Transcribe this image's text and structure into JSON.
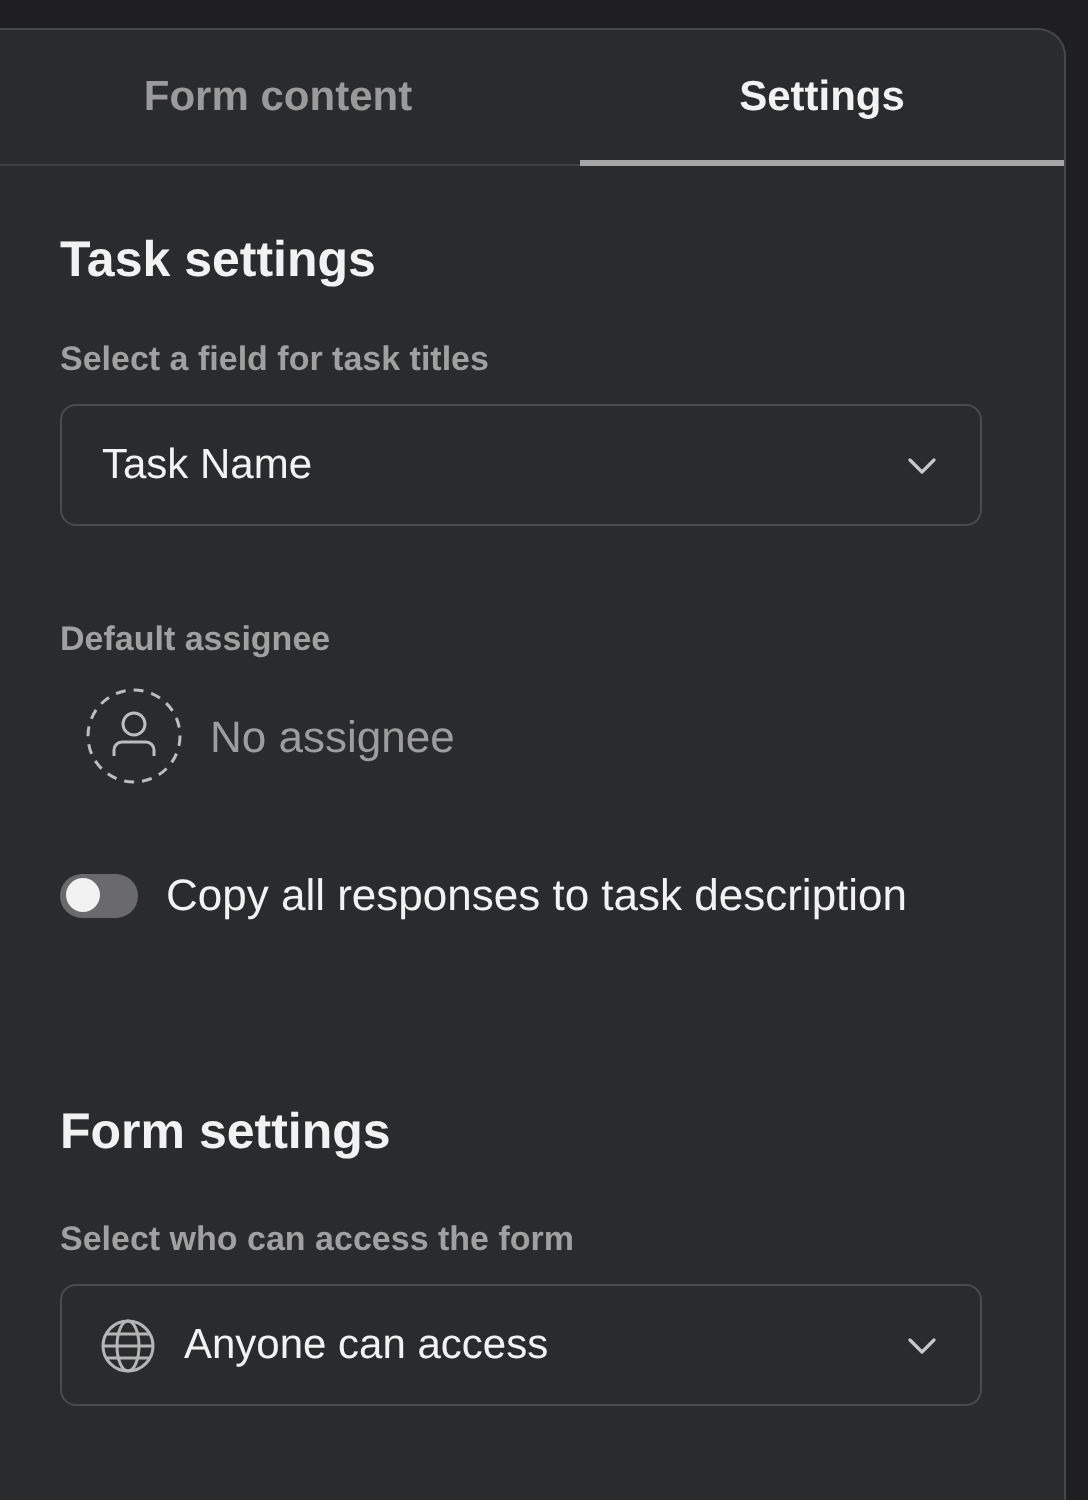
{
  "tabs": [
    {
      "label": "Form content",
      "selected": false
    },
    {
      "label": "Settings",
      "selected": true
    }
  ],
  "task_settings": {
    "heading": "Task settings",
    "title_field": {
      "label": "Select a field for task titles",
      "value": "Task Name"
    },
    "default_assignee": {
      "label": "Default assignee",
      "value": "No assignee"
    },
    "copy_toggle": {
      "label": "Copy all responses to task description",
      "on": false
    }
  },
  "form_settings": {
    "heading": "Form settings",
    "access": {
      "label": "Select who can access the form",
      "value": "Anyone can access"
    }
  }
}
